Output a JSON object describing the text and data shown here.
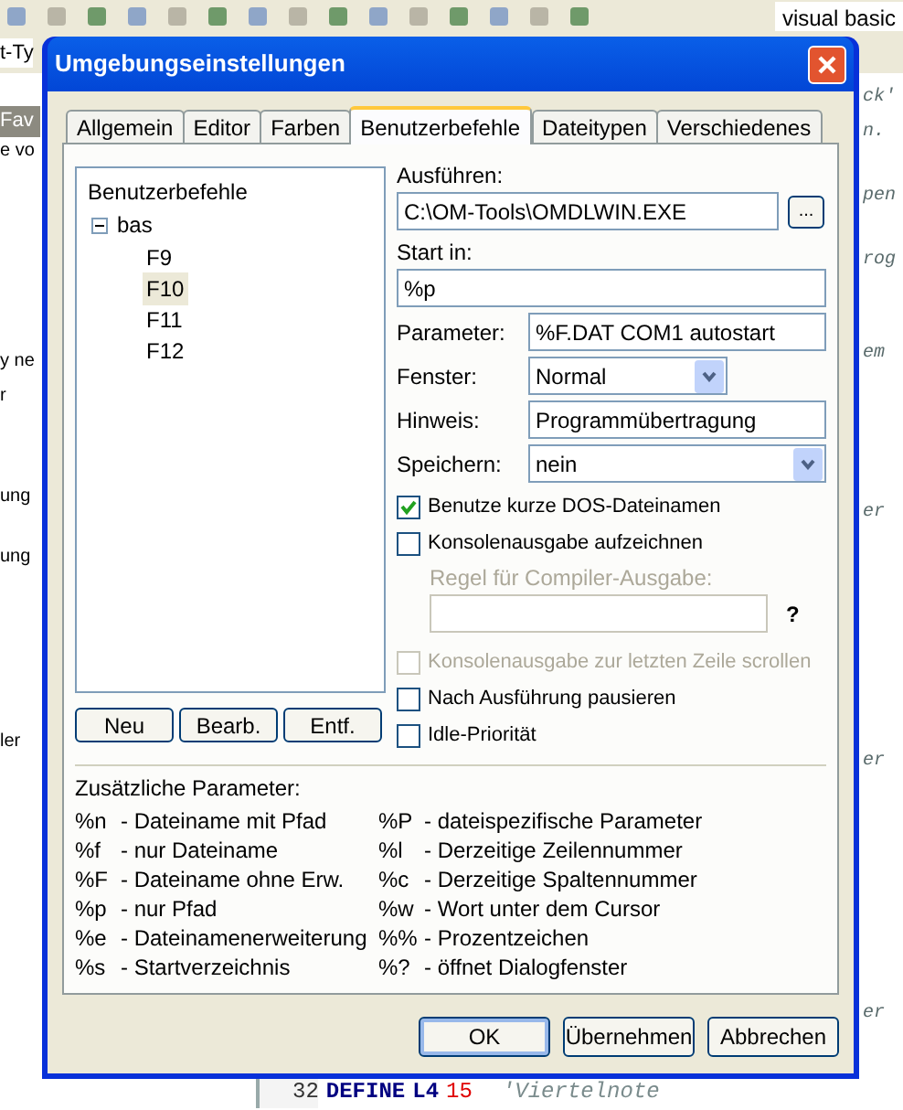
{
  "background": {
    "toolbar_text": "visual basic",
    "tab_fragment": "t-Ty",
    "favorites_fragment": "Fav",
    "left_fragments": [
      "e vo",
      "y ne",
      "r",
      "ung",
      "ung",
      "ler"
    ],
    "right_fragments": [
      "ck'",
      "n.",
      "pen",
      "rog",
      "em",
      "er",
      "er",
      "er"
    ],
    "code_line": {
      "number": "32",
      "keyword": "DEFINE",
      "name": "L4",
      "value": "15",
      "comment": "'Viertelnote"
    }
  },
  "window": {
    "title": "Umgebungseinstellungen"
  },
  "tabs": [
    {
      "label": "Allgemein",
      "selected": false
    },
    {
      "label": "Editor",
      "selected": false
    },
    {
      "label": "Farben",
      "selected": false
    },
    {
      "label": "Benutzerbefehle",
      "selected": true
    },
    {
      "label": "Dateitypen",
      "selected": false
    },
    {
      "label": "Verschiedenes",
      "selected": false
    }
  ],
  "tree": {
    "label": "Benutzerbefehle",
    "children": [
      {
        "label": "bas",
        "expanded": true,
        "selected": false,
        "children": [
          {
            "label": "F9",
            "selected": false
          },
          {
            "label": "F10",
            "selected": true
          },
          {
            "label": "F11",
            "selected": false
          },
          {
            "label": "F12",
            "selected": false
          }
        ]
      }
    ]
  },
  "tree_buttons": [
    "Neu",
    "Bearb.",
    "Entf."
  ],
  "form": {
    "run_label": "Ausführen:",
    "run_value": "C:\\OM-Tools\\OMDLWIN.EXE",
    "browse": "...",
    "start_label": "Start in:",
    "start_value": "%p",
    "rows": [
      {
        "kind": "text",
        "label": "Parameter:",
        "value": "%F.DAT COM1 autostart"
      },
      {
        "kind": "select",
        "label": "Fenster:",
        "value": "Normal"
      },
      {
        "kind": "text",
        "label": "Hinweis:",
        "value": "Programmübertragung"
      },
      {
        "kind": "select",
        "label": "Speichern:",
        "value": "nein"
      }
    ]
  },
  "options": [
    {
      "kind": "check",
      "label": "Benutze kurze DOS-Dateinamen",
      "checked": true,
      "disabled": false
    },
    {
      "kind": "check",
      "label": "Konsolenausgabe aufzeichnen",
      "checked": false,
      "disabled": false
    },
    {
      "kind": "rule",
      "label": "Regel für Compiler-Ausgabe:",
      "help": "?",
      "disabled": true
    },
    {
      "kind": "check",
      "label": "Konsolenausgabe zur letzten Zeile scrollen",
      "checked": false,
      "disabled": true
    },
    {
      "kind": "check",
      "label": "Nach Ausführung pausieren",
      "checked": false,
      "disabled": false
    },
    {
      "kind": "check",
      "label": "Idle-Priorität",
      "checked": false,
      "disabled": false
    }
  ],
  "parameters": {
    "title": "Zusätzliche Parameter:",
    "left": [
      {
        "code": "%n",
        "text": "- Dateiname mit Pfad"
      },
      {
        "code": "%f",
        "text": "- nur Dateiname"
      },
      {
        "code": "%F",
        "text": "- Dateiname ohne Erw."
      },
      {
        "code": "%p",
        "text": "- nur Pfad"
      },
      {
        "code": "%e",
        "text": "- Dateinamenerweiterung"
      },
      {
        "code": "%s",
        "text": "- Startverzeichnis"
      }
    ],
    "right": [
      {
        "code": "%P",
        "text": "- dateispezifische Parameter"
      },
      {
        "code": "%l",
        "text": "- Derzeitige Zeilennummer"
      },
      {
        "code": "%c",
        "text": "- Derzeitige Spaltennummer"
      },
      {
        "code": "%w",
        "text": "- Wort unter dem Cursor"
      },
      {
        "code": "%%",
        "text": "- Prozentzeichen"
      },
      {
        "code": "%?",
        "text": "- öffnet Dialogfenster"
      }
    ]
  },
  "buttons": [
    {
      "label": "OK",
      "default": true
    },
    {
      "label": "Übernehmen",
      "default": false
    },
    {
      "label": "Abbrechen",
      "default": false
    }
  ]
}
